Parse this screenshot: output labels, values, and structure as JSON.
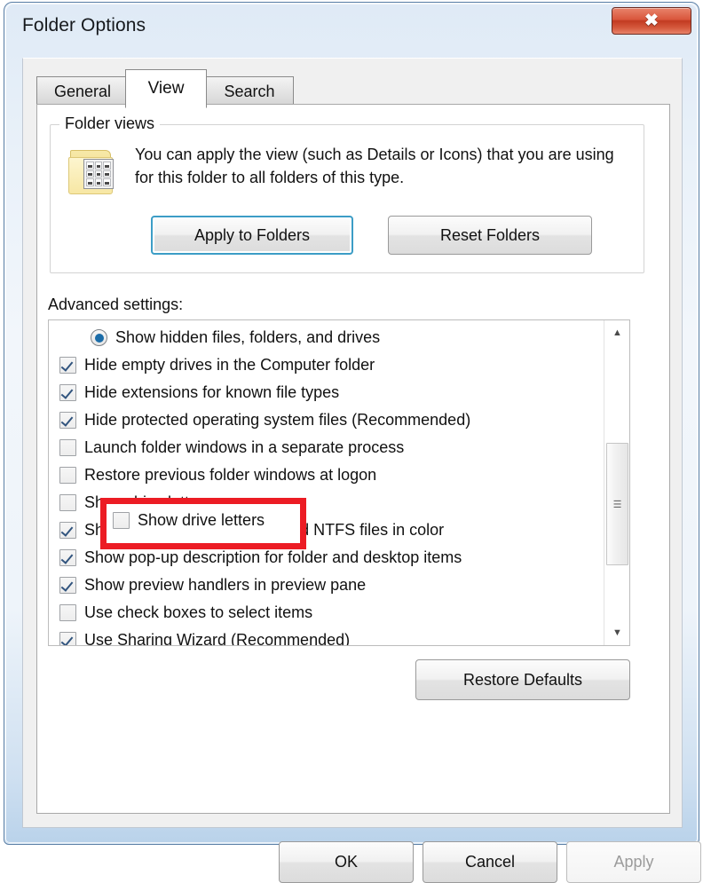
{
  "window": {
    "title": "Folder Options",
    "close_label": "✖",
    "close_icon": "close-icon"
  },
  "tabs": [
    {
      "label": "General",
      "active": false
    },
    {
      "label": "View",
      "active": true
    },
    {
      "label": "Search",
      "active": false
    }
  ],
  "folder_views": {
    "group_label": "Folder views",
    "description": "You can apply the view (such as Details or Icons) that you are using for this folder to all folders of this type.",
    "icon": "folder-views-icon",
    "apply_button": "Apply to Folders",
    "reset_button": "Reset Folders"
  },
  "advanced": {
    "label": "Advanced settings:",
    "items": [
      {
        "text": "Show hidden files, folders, and drives",
        "control": "radio",
        "state": "selected",
        "indent": true
      },
      {
        "text": "Hide empty drives in the Computer folder",
        "control": "checkbox",
        "state": "checked",
        "indent": false
      },
      {
        "text": "Hide extensions for known file types",
        "control": "checkbox",
        "state": "checked",
        "indent": false
      },
      {
        "text": "Hide protected operating system files (Recommended)",
        "control": "checkbox",
        "state": "checked",
        "indent": false
      },
      {
        "text": "Launch folder windows in a separate process",
        "control": "checkbox",
        "state": "unchecked",
        "indent": false
      },
      {
        "text": "Restore previous folder windows at logon",
        "control": "checkbox",
        "state": "unchecked",
        "indent": false
      },
      {
        "text": "Show drive letters",
        "control": "checkbox",
        "state": "unchecked",
        "indent": false
      },
      {
        "text": "Show encrypted or compressed NTFS files in color",
        "control": "checkbox",
        "state": "checked",
        "indent": false
      },
      {
        "text": "Show pop-up description for folder and desktop items",
        "control": "checkbox",
        "state": "checked",
        "indent": false
      },
      {
        "text": "Show preview handlers in preview pane",
        "control": "checkbox",
        "state": "checked",
        "indent": false
      },
      {
        "text": "Use check boxes to select items",
        "control": "checkbox",
        "state": "unchecked",
        "indent": false
      },
      {
        "text": "Use Sharing Wizard (Recommended)",
        "control": "checkbox",
        "state": "checked",
        "indent": false
      }
    ],
    "scroll_up_glyph": "▲",
    "scroll_down_glyph": "▼",
    "scroll_thumb_grip": "☰",
    "restore_defaults_button": "Restore Defaults"
  },
  "footer": {
    "ok": "OK",
    "cancel": "Cancel",
    "apply": "Apply"
  },
  "annotation": {
    "highlight_label": "Show drive letters",
    "highlight_color": "#ec1c24"
  }
}
